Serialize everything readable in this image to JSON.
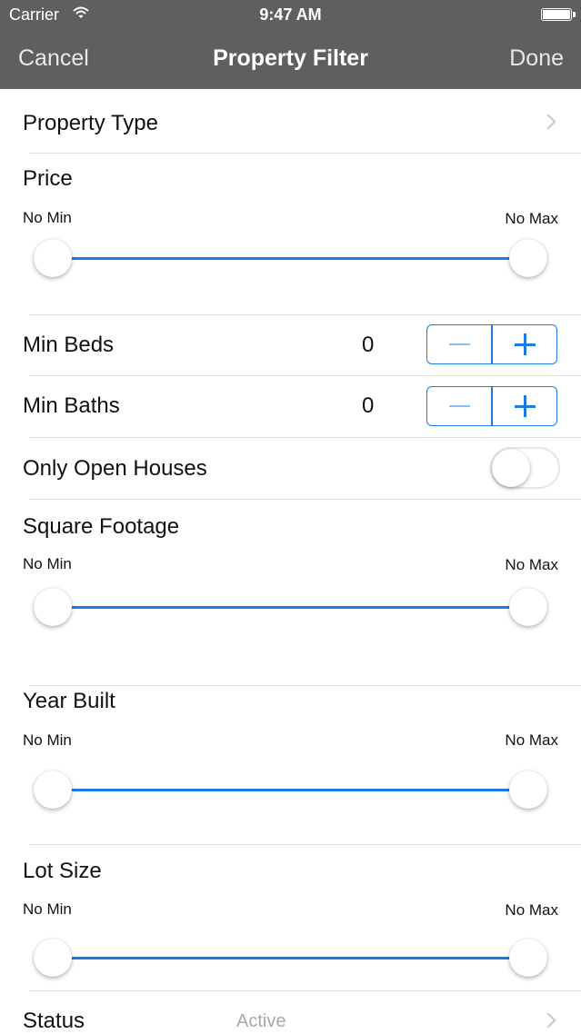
{
  "status_bar": {
    "carrier": "Carrier",
    "time": "9:47 AM"
  },
  "nav": {
    "cancel": "Cancel",
    "title": "Property Filter",
    "done": "Done"
  },
  "property_type": {
    "label": "Property Type"
  },
  "price": {
    "label": "Price",
    "min_label": "No Min",
    "max_label": "No Max",
    "range": [
      0,
      1
    ]
  },
  "min_beds": {
    "label": "Min Beds",
    "value": "0"
  },
  "min_baths": {
    "label": "Min Baths",
    "value": "0"
  },
  "open_houses": {
    "label": "Only Open Houses",
    "on": false
  },
  "square_footage": {
    "label": "Square Footage",
    "min_label": "No Min",
    "max_label": "No Max",
    "range": [
      0,
      1
    ]
  },
  "year_built": {
    "label": "Year Built",
    "min_label": "No Min",
    "max_label": "No Max",
    "range": [
      0,
      1
    ]
  },
  "lot_size": {
    "label": "Lot Size",
    "min_label": "No Min",
    "max_label": "No Max",
    "range": [
      0,
      1
    ]
  },
  "status": {
    "label": "Status",
    "value": "Active"
  },
  "colors": {
    "accent": "#1d7ae5",
    "nav_bg": "#5f5f5f"
  }
}
